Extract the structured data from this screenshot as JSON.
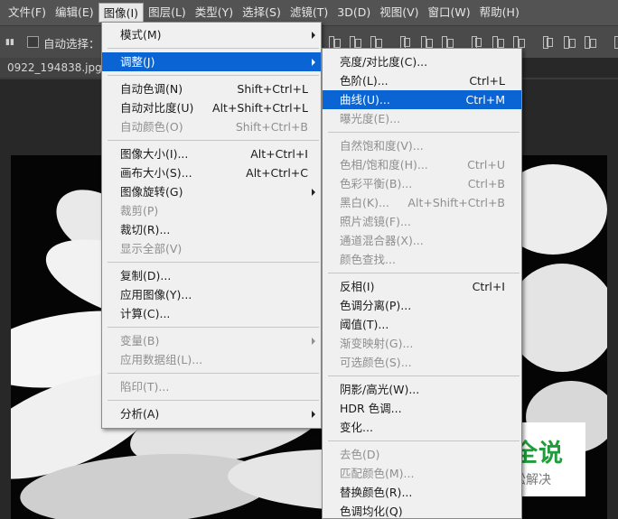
{
  "menubar": [
    {
      "label": "文件(F)"
    },
    {
      "label": "编辑(E)"
    },
    {
      "label": "图像(I)",
      "active": true
    },
    {
      "label": "图层(L)"
    },
    {
      "label": "类型(Y)"
    },
    {
      "label": "选择(S)"
    },
    {
      "label": "滤镜(T)"
    },
    {
      "label": "3D(D)"
    },
    {
      "label": "视图(V)"
    },
    {
      "label": "窗口(W)"
    },
    {
      "label": "帮助(H)"
    }
  ],
  "options_bar": {
    "auto_select_label": "自动选择："
  },
  "document_tab": {
    "title": "0922_194838.jpg @"
  },
  "image_menu": [
    {
      "label": "模式(M)",
      "submenu": true
    },
    {
      "sep": true
    },
    {
      "label": "调整(J)",
      "submenu": true,
      "highlight": true
    },
    {
      "sep": true
    },
    {
      "label": "自动色调(N)",
      "shortcut": "Shift+Ctrl+L"
    },
    {
      "label": "自动对比度(U)",
      "shortcut": "Alt+Shift+Ctrl+L"
    },
    {
      "label": "自动颜色(O)",
      "shortcut": "Shift+Ctrl+B",
      "disabled": true
    },
    {
      "sep": true
    },
    {
      "label": "图像大小(I)...",
      "shortcut": "Alt+Ctrl+I"
    },
    {
      "label": "画布大小(S)...",
      "shortcut": "Alt+Ctrl+C"
    },
    {
      "label": "图像旋转(G)",
      "submenu": true
    },
    {
      "label": "裁剪(P)",
      "disabled": true
    },
    {
      "label": "裁切(R)..."
    },
    {
      "label": "显示全部(V)",
      "disabled": true
    },
    {
      "sep": true
    },
    {
      "label": "复制(D)..."
    },
    {
      "label": "应用图像(Y)..."
    },
    {
      "label": "计算(C)..."
    },
    {
      "sep": true
    },
    {
      "label": "变量(B)",
      "submenu": true,
      "disabled": true
    },
    {
      "label": "应用数据组(L)...",
      "disabled": true
    },
    {
      "sep": true
    },
    {
      "label": "陷印(T)...",
      "disabled": true
    },
    {
      "sep": true
    },
    {
      "label": "分析(A)",
      "submenu": true
    }
  ],
  "adjust_submenu": [
    {
      "label": "亮度/对比度(C)..."
    },
    {
      "label": "色阶(L)...",
      "shortcut": "Ctrl+L"
    },
    {
      "label": "曲线(U)...",
      "shortcut": "Ctrl+M",
      "highlight": true
    },
    {
      "label": "曝光度(E)...",
      "disabled": true
    },
    {
      "sep": true
    },
    {
      "label": "自然饱和度(V)...",
      "disabled": true
    },
    {
      "label": "色相/饱和度(H)...",
      "shortcut": "Ctrl+U",
      "disabled": true
    },
    {
      "label": "色彩平衡(B)...",
      "shortcut": "Ctrl+B",
      "disabled": true
    },
    {
      "label": "黑白(K)...",
      "shortcut": "Alt+Shift+Ctrl+B",
      "disabled": true
    },
    {
      "label": "照片滤镜(F)...",
      "disabled": true
    },
    {
      "label": "通道混合器(X)...",
      "disabled": true
    },
    {
      "label": "颜色查找...",
      "disabled": true
    },
    {
      "sep": true
    },
    {
      "label": "反相(I)",
      "shortcut": "Ctrl+I"
    },
    {
      "label": "色调分离(P)..."
    },
    {
      "label": "阈值(T)..."
    },
    {
      "label": "渐变映射(G)...",
      "disabled": true
    },
    {
      "label": "可选颜色(S)...",
      "disabled": true
    },
    {
      "sep": true
    },
    {
      "label": "阴影/高光(W)..."
    },
    {
      "label": "HDR 色调..."
    },
    {
      "label": "变化..."
    },
    {
      "sep": true
    },
    {
      "label": "去色(D)",
      "disabled": true
    },
    {
      "label": "匹配颜色(M)...",
      "disabled": true
    },
    {
      "label": "替换颜色(R)..."
    },
    {
      "label": "色调均化(Q)"
    }
  ],
  "watermark": {
    "title": "百科全说",
    "subtitle": "助你轻松解决"
  },
  "colors": {
    "menu_highlight": "#0a64d4",
    "watermark_green": "#1f9d3a"
  }
}
